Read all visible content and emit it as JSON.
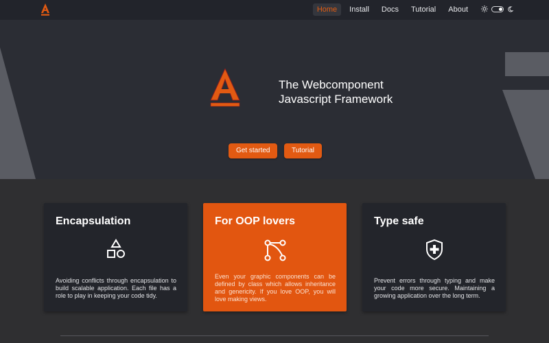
{
  "header": {
    "logo_icon": "framework-logo-icon",
    "nav": [
      {
        "label": "Home",
        "active": true
      },
      {
        "label": "Install",
        "active": false
      },
      {
        "label": "Docs",
        "active": false
      },
      {
        "label": "Tutorial",
        "active": false
      },
      {
        "label": "About",
        "active": false
      }
    ],
    "theme": {
      "light_icon": "sun-icon",
      "dark_icon": "moon-icon",
      "mode": "dark"
    }
  },
  "hero": {
    "title": "The Webcomponent\nJavascript Framework",
    "buttons": {
      "get_started": "Get started",
      "tutorial": "Tutorial"
    }
  },
  "features": [
    {
      "title": "Encapsulation",
      "icon": "shapes-icon",
      "text": "Avoiding conflicts through encapsulation to build scalable application. Each file has a role to play in keeping your code tidy."
    },
    {
      "title": "For OOP lovers",
      "icon": "graph-nodes-icon",
      "text": "Even your graphic components can be defined by class which allows inheritance and genericity. If you love OOP, you will love making views."
    },
    {
      "title": "Type safe",
      "icon": "shield-plus-icon",
      "text": "Prevent errors through typing and make your code more secure. Maintaining a growing application over the long term."
    }
  ],
  "colors": {
    "accent": "#e25a12",
    "header_bg": "#22242b",
    "hero_bg": "#2b2d34",
    "card_bg": "#23252b",
    "body_bg": "#2f2f31"
  }
}
